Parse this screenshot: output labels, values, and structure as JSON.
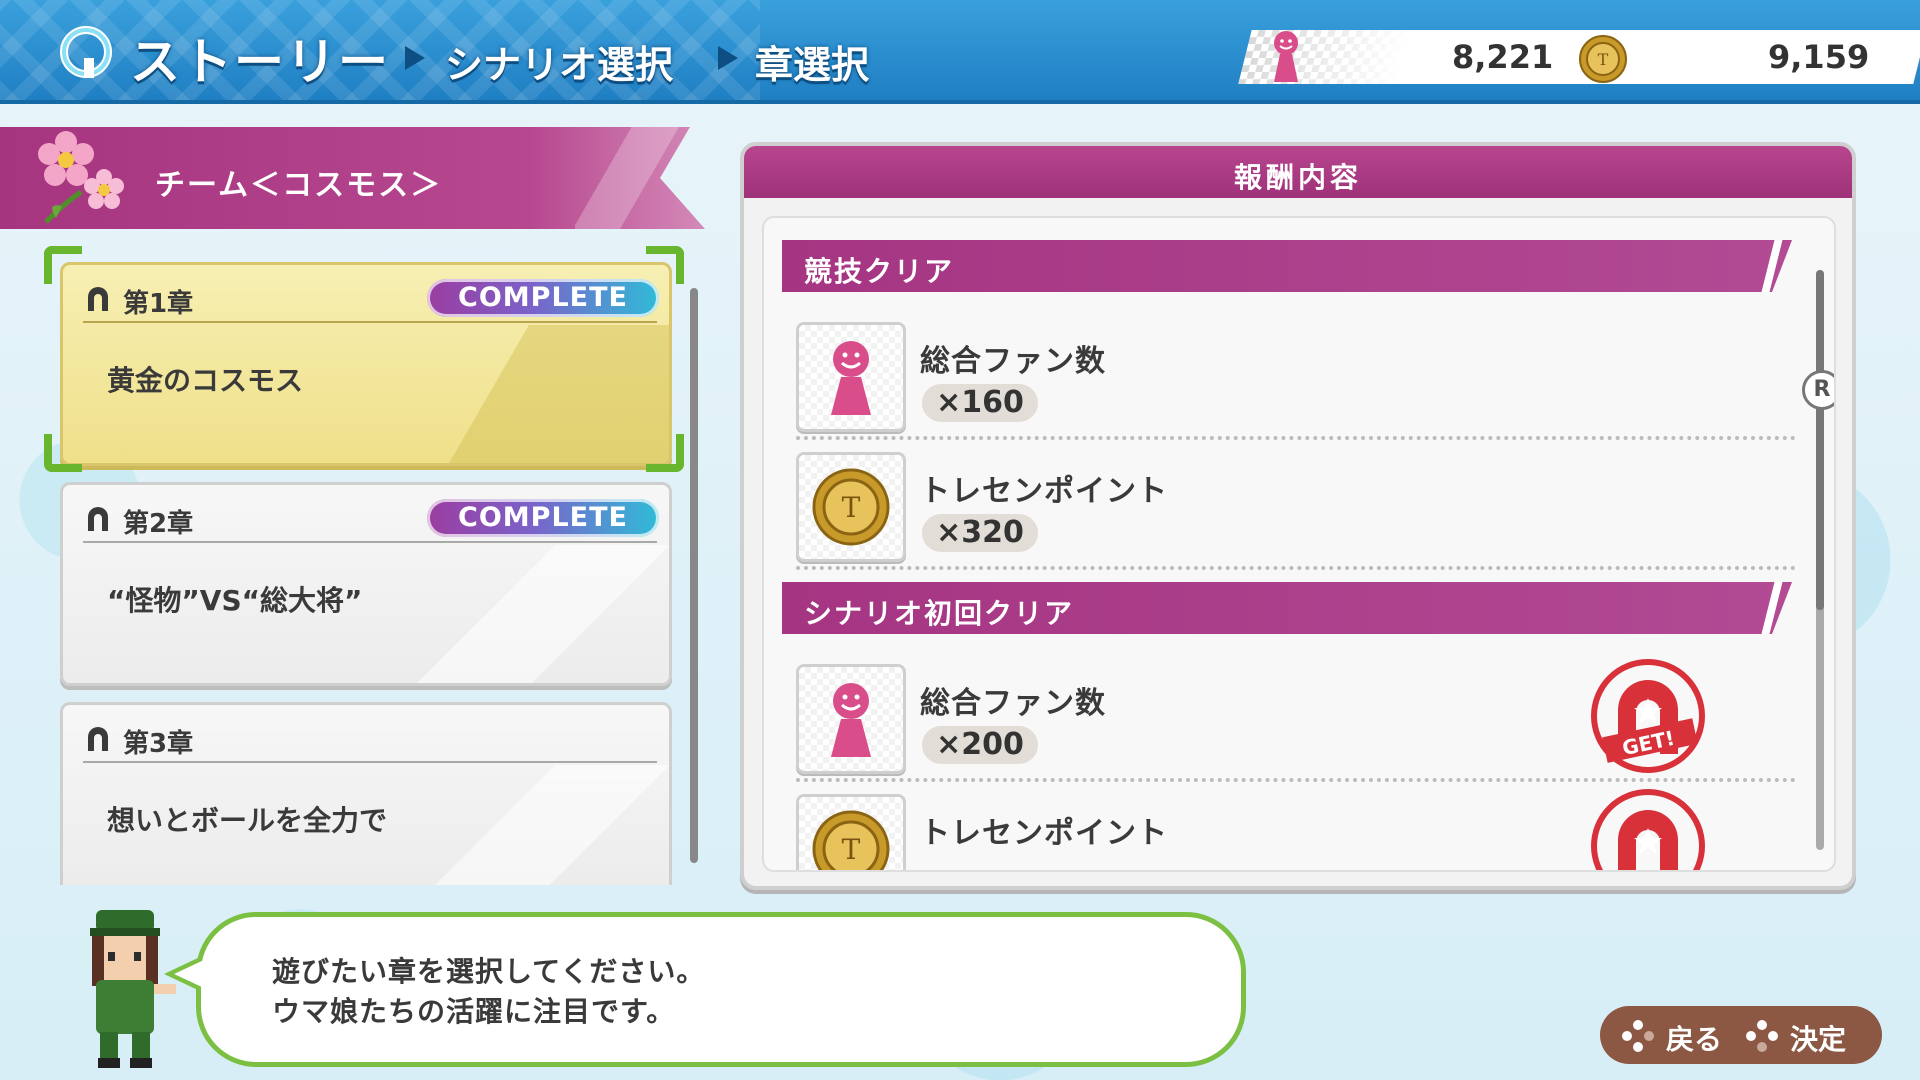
{
  "header": {
    "breadcrumb_main": "ストーリー",
    "breadcrumb_1": "シナリオ選択",
    "breadcrumb_2": "章選択",
    "fans": "8,221",
    "coins": "9,159"
  },
  "team": {
    "name": "チーム＜コスモス＞"
  },
  "chapters": [
    {
      "num": "第1章",
      "status": "COMPLETE",
      "title": "黄金のコスモス",
      "selected": true
    },
    {
      "num": "第2章",
      "status": "COMPLETE",
      "title": "“怪物”VS“総大将”",
      "selected": false
    },
    {
      "num": "第3章",
      "status": "",
      "title": "想いとボールを全力で",
      "selected": false
    }
  ],
  "rewards": {
    "title": "報酬内容",
    "sections": [
      {
        "label": "競技クリア",
        "items": [
          {
            "name": "総合ファン数",
            "qty": "×160",
            "icon": "fan-figure-icon",
            "got": false
          },
          {
            "name": "トレセンポイント",
            "qty": "×320",
            "icon": "trecen-coin-icon",
            "got": false
          }
        ]
      },
      {
        "label": "シナリオ初回クリア",
        "items": [
          {
            "name": "総合ファン数",
            "qty": "×200",
            "icon": "fan-figure-icon",
            "got": true,
            "stamp": "GET!"
          },
          {
            "name": "トレセンポイント",
            "qty": "",
            "icon": "trecen-coin-icon",
            "got": true
          }
        ]
      }
    ],
    "scroll_button": "R"
  },
  "dialog": {
    "line1": "遊びたい章を選択してください。",
    "line2": "ウマ娘たちの活躍に注目です。"
  },
  "controls": {
    "back": "戻る",
    "confirm": "決定"
  },
  "colors": {
    "header": "#2a8fd0",
    "magenta": "#a53582",
    "selected_card": "#f2e59a",
    "selection_corner": "#68b52e",
    "dialog_border": "#7bc043",
    "controls_bg": "#8c5844"
  }
}
